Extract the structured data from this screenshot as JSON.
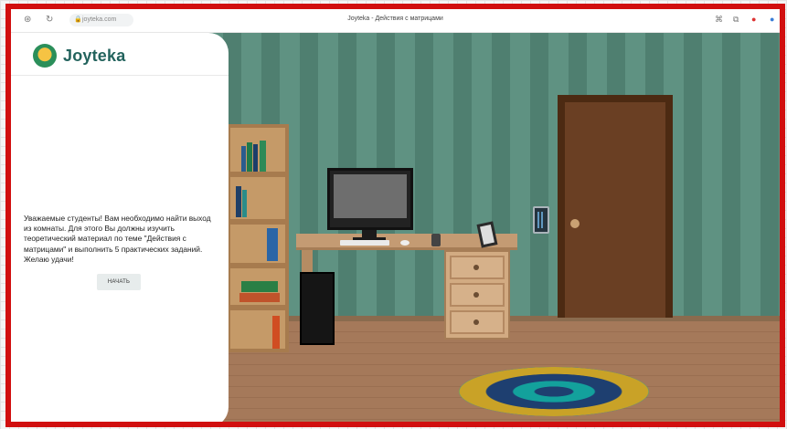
{
  "browser": {
    "url": "joyteka.com",
    "tab_title": "Joyteka - Действия с матрицами",
    "icons": [
      "shield-icon",
      "reload-icon",
      "lock-icon",
      "bookmark-icon",
      "tab-icon",
      "extension-icon",
      "profile-icon"
    ]
  },
  "sidebar": {
    "brand": "Joyteka",
    "intro_text": "Уважаемые студенты! Вам необходимо найти выход из комнаты. Для этого Вы должны изучить теоретический материал по теме \"Действия с матрицами\" и выполнить 5 практических заданий. Желаю удачи!",
    "start_label": "НАЧАТЬ"
  },
  "colors": {
    "frame_border": "#d10f0f",
    "brand_teal": "#23635d",
    "wall_green": "#5f9282",
    "door_brown": "#6a3f23",
    "floor_wood": "#a5795a"
  }
}
